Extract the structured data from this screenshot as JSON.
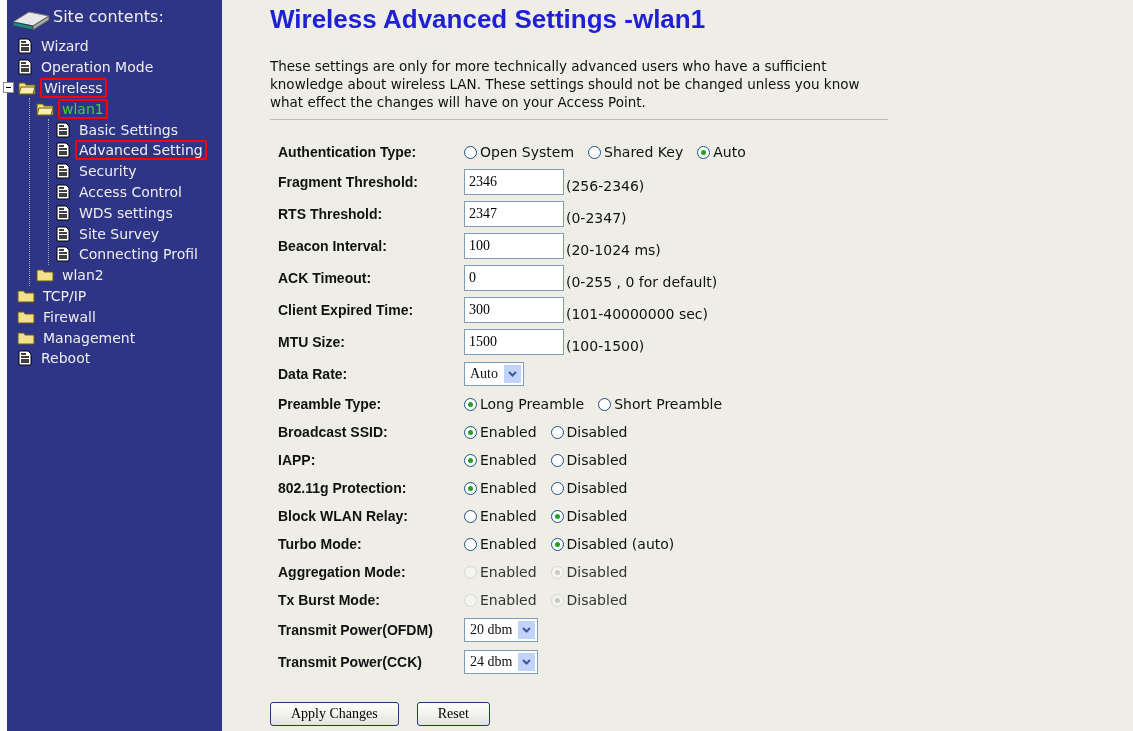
{
  "sidebar": {
    "title": "Site contents:",
    "items": [
      {
        "label": "Wizard",
        "kind": "page",
        "highlighted": false,
        "current": false
      },
      {
        "label": "Operation Mode",
        "kind": "page",
        "highlighted": false,
        "current": false
      },
      {
        "label": "Wireless",
        "kind": "folder",
        "highlighted": true,
        "current": false,
        "expanded": true,
        "children": [
          {
            "label": "wlan1",
            "kind": "folder",
            "highlighted": true,
            "current": true,
            "children": [
              {
                "label": "Basic Settings",
                "kind": "page",
                "highlighted": false,
                "current": false
              },
              {
                "label": "Advanced Setting",
                "kind": "page",
                "highlighted": true,
                "current": false
              },
              {
                "label": "Security",
                "kind": "page",
                "highlighted": false,
                "current": false
              },
              {
                "label": "Access Control",
                "kind": "page",
                "highlighted": false,
                "current": false
              },
              {
                "label": "WDS settings",
                "kind": "page",
                "highlighted": false,
                "current": false
              },
              {
                "label": "Site Survey",
                "kind": "page",
                "highlighted": false,
                "current": false
              },
              {
                "label": "Connecting Profil",
                "kind": "page",
                "highlighted": false,
                "current": false
              }
            ]
          },
          {
            "label": "wlan2",
            "kind": "folder",
            "highlighted": false,
            "current": false
          }
        ]
      },
      {
        "label": "TCP/IP",
        "kind": "folder",
        "highlighted": false,
        "current": false
      },
      {
        "label": "Firewall",
        "kind": "folder",
        "highlighted": false,
        "current": false
      },
      {
        "label": "Management",
        "kind": "folder",
        "highlighted": false,
        "current": false
      },
      {
        "label": "Reboot",
        "kind": "page",
        "highlighted": false,
        "current": false
      }
    ]
  },
  "page": {
    "title": "Wireless Advanced Settings -wlan1",
    "description": "These settings are only for more technically advanced users who have a sufficient knowledge about wireless LAN. These settings should not be changed unless you know what effect the changes will have on your Access Point.",
    "rows": [
      {
        "kind": "radio",
        "label": "Authentication Type:",
        "options": [
          {
            "label": "Open System",
            "selected": false,
            "disabled": false
          },
          {
            "label": "Shared Key",
            "selected": false,
            "disabled": false
          },
          {
            "label": "Auto",
            "selected": true,
            "disabled": false
          }
        ]
      },
      {
        "kind": "text",
        "label": "Fragment Threshold:",
        "value": "2346",
        "hint": "(256-2346)"
      },
      {
        "kind": "text",
        "label": "RTS Threshold:",
        "value": "2347",
        "hint": "(0-2347)"
      },
      {
        "kind": "text",
        "label": "Beacon Interval:",
        "value": "100",
        "hint": "(20-1024 ms)"
      },
      {
        "kind": "text",
        "label": "ACK Timeout:",
        "value": "0",
        "hint": "(0-255 , 0 for default)"
      },
      {
        "kind": "text",
        "label": "Client Expired Time:",
        "value": "300",
        "hint": "(101-40000000 sec)"
      },
      {
        "kind": "text",
        "label": "MTU Size:",
        "value": "1500",
        "hint": "(100-1500)"
      },
      {
        "kind": "select",
        "label": "Data Rate:",
        "value": "Auto"
      },
      {
        "kind": "radio",
        "label": "Preamble Type:",
        "options": [
          {
            "label": "Long Preamble",
            "selected": true,
            "disabled": false
          },
          {
            "label": "Short Preamble",
            "selected": false,
            "disabled": false
          }
        ]
      },
      {
        "kind": "radio",
        "label": "Broadcast SSID:",
        "options": [
          {
            "label": "Enabled",
            "selected": true,
            "disabled": false
          },
          {
            "label": "Disabled",
            "selected": false,
            "disabled": false
          }
        ]
      },
      {
        "kind": "radio",
        "label": "IAPP:",
        "options": [
          {
            "label": "Enabled",
            "selected": true,
            "disabled": false
          },
          {
            "label": "Disabled",
            "selected": false,
            "disabled": false
          }
        ]
      },
      {
        "kind": "radio",
        "label": "802.11g Protection:",
        "options": [
          {
            "label": "Enabled",
            "selected": true,
            "disabled": false
          },
          {
            "label": "Disabled",
            "selected": false,
            "disabled": false
          }
        ]
      },
      {
        "kind": "radio",
        "label": "Block WLAN Relay:",
        "options": [
          {
            "label": "Enabled",
            "selected": false,
            "disabled": false
          },
          {
            "label": "Disabled",
            "selected": true,
            "disabled": false
          }
        ]
      },
      {
        "kind": "radio",
        "label": "Turbo Mode:",
        "options": [
          {
            "label": "Enabled",
            "selected": false,
            "disabled": false
          },
          {
            "label": "Disabled (auto)",
            "selected": true,
            "disabled": false
          }
        ]
      },
      {
        "kind": "radio",
        "label": "Aggregation Mode:",
        "options": [
          {
            "label": "Enabled",
            "selected": false,
            "disabled": true
          },
          {
            "label": "Disabled",
            "selected": true,
            "disabled": true
          }
        ]
      },
      {
        "kind": "radio",
        "label": "Tx Burst Mode:",
        "options": [
          {
            "label": "Enabled",
            "selected": false,
            "disabled": true
          },
          {
            "label": "Disabled",
            "selected": true,
            "disabled": true
          }
        ]
      },
      {
        "kind": "select",
        "label": "Transmit Power(OFDM)",
        "value": "20 dbm"
      },
      {
        "kind": "select",
        "label": "Transmit Power(CCK)",
        "value": "24 dbm"
      }
    ],
    "buttons": [
      "Apply Changes",
      "Reset"
    ]
  }
}
